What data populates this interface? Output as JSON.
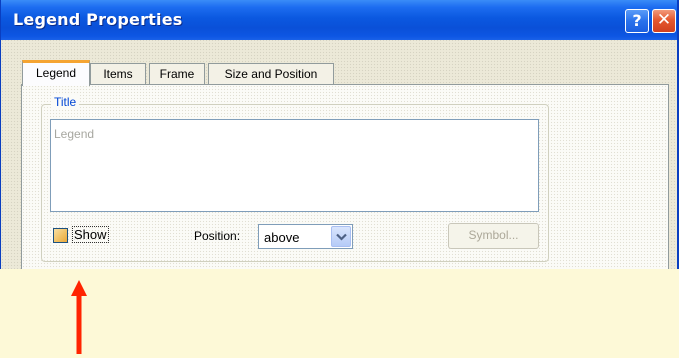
{
  "window": {
    "title": "Legend Properties",
    "help_label": "?",
    "close_label": "✕"
  },
  "tabs": [
    {
      "label": "Legend",
      "active": true
    },
    {
      "label": "Items",
      "active": false
    },
    {
      "label": "Frame",
      "active": false
    },
    {
      "label": "Size and Position",
      "active": false
    }
  ],
  "title_group": {
    "label": "Title",
    "text_value": "Legend"
  },
  "show_checkbox": {
    "label": "Show",
    "checked": false
  },
  "position": {
    "label": "Position:",
    "value": "above"
  },
  "symbol_button": {
    "label": "Symbol...",
    "enabled": false
  },
  "colors": {
    "titlebar": "#0a50d8",
    "dialog_bg": "#ece9d8",
    "group_title": "#0046d5",
    "annotation_arrow": "#ff2400",
    "page_bg": "#fdf9d7"
  },
  "icons": {
    "help": "question-icon",
    "close": "close-icon",
    "dropdown": "chevron-down-icon",
    "annotation": "arrow-up-icon"
  }
}
